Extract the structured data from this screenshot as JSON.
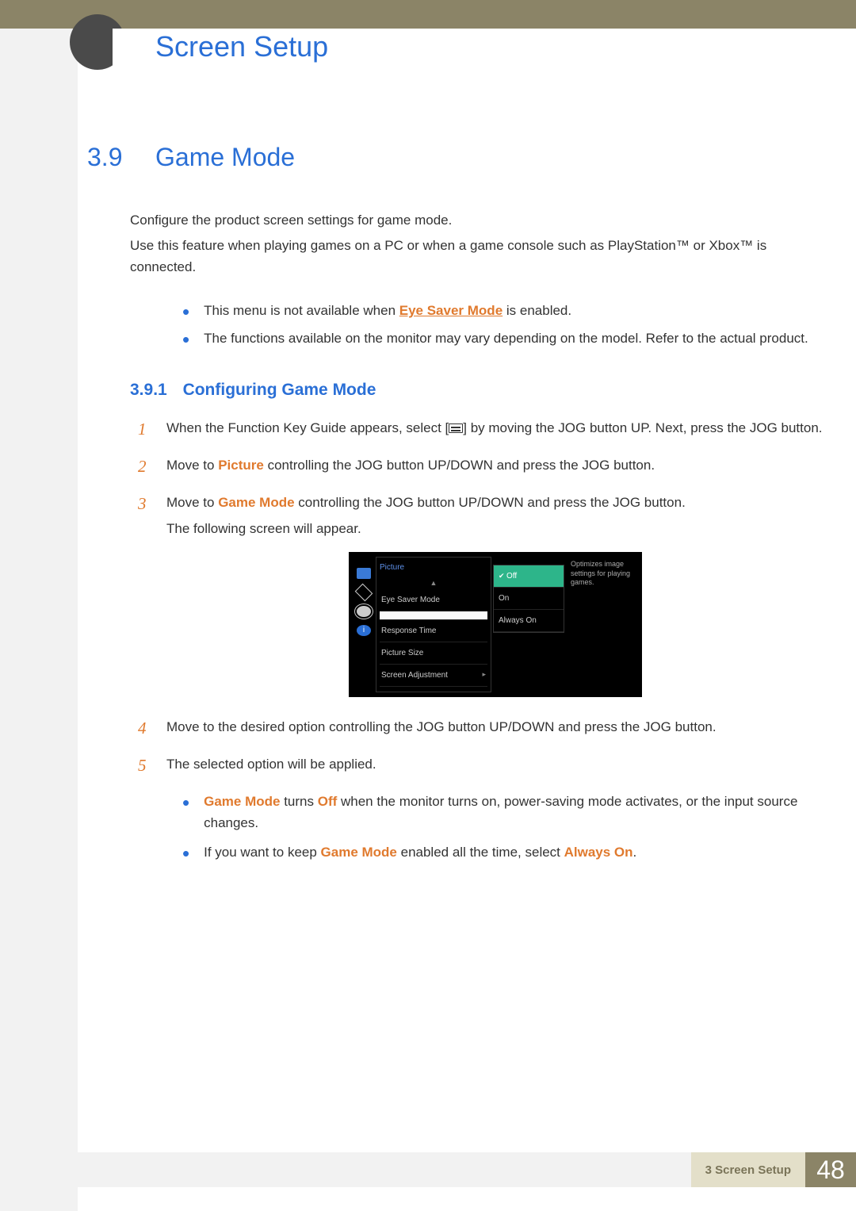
{
  "chapter_title": "Screen Setup",
  "section": {
    "number": "3.9",
    "title": "Game Mode",
    "intro1": "Configure the product screen settings for game mode.",
    "intro2": "Use this feature when playing games on a PC or when a game console such as PlayStation™ or Xbox™ is connected.",
    "note1_pre": "This menu is not available when ",
    "note1_hl": "Eye Saver Mode",
    "note1_post": " is enabled.",
    "note2": "The functions available on the monitor may vary depending on the model. Refer to the actual product."
  },
  "subsection": {
    "number": "3.9.1",
    "title": "Configuring Game Mode"
  },
  "steps": {
    "s1a": "When the Function Key Guide appears, select [",
    "s1b": "] by moving the JOG button UP. Next, press the JOG button.",
    "s2_pre": "Move to ",
    "s2_hl": "Picture",
    "s2_post": " controlling the JOG button UP/DOWN and press the JOG button.",
    "s3_pre": "Move to ",
    "s3_hl": "Game Mode",
    "s3_post": " controlling the JOG button UP/DOWN and press the JOG button.",
    "s3_extra": "The following screen will appear.",
    "s4": "Move to the desired option controlling the JOG button UP/DOWN and press the JOG button.",
    "s5": "The selected option will be applied."
  },
  "osd": {
    "menu_title": "Picture",
    "items": [
      "Eye Saver Mode",
      "",
      "Response Time",
      "Picture Size",
      "Screen Adjustment"
    ],
    "options": [
      "Off",
      "On",
      "Always On"
    ],
    "desc": "Optimizes image settings for playing games."
  },
  "bottom_notes": {
    "n1_hl1": "Game Mode",
    "n1_mid": " turns ",
    "n1_hl2": "Off",
    "n1_post": " when the monitor turns on, power-saving mode activates, or the input source changes.",
    "n2_pre": "If you want to keep ",
    "n2_hl1": "Game Mode",
    "n2_mid": " enabled all the time, select ",
    "n2_hl2": "Always On",
    "n2_post": "."
  },
  "footer": {
    "crumb_num": "3",
    "crumb_title": "Screen Setup",
    "page": "48"
  }
}
